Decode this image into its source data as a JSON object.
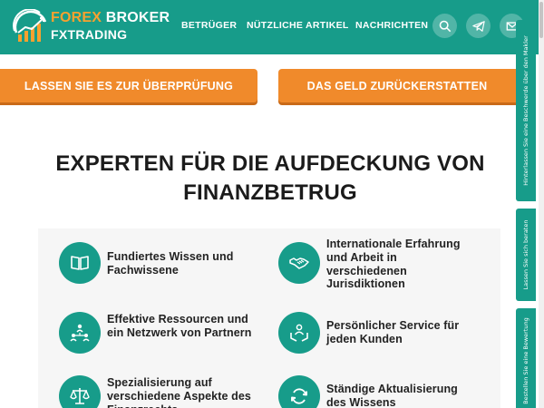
{
  "brand": {
    "line1_accent": "FOREX",
    "line1_rest": " BROKER",
    "line2": "FXTRADING"
  },
  "nav": [
    {
      "label": "BETRÜGER"
    },
    {
      "label": "NÜTZLICHE ARTIKEL"
    },
    {
      "label": "NACHRICHTEN"
    }
  ],
  "header_icons": [
    "search-icon",
    "telegram-icon",
    "mail-icon"
  ],
  "cta": {
    "review_label": "LASSEN SIE ES ZUR ÜBERPRÜFUNG",
    "refund_label": "DAS GELD ZURÜCKERSTATTEN"
  },
  "headline": "EXPERTEN FÜR DIE AUFDECKUNG VON FINANZBETRUG",
  "features": [
    {
      "icon": "book-icon",
      "text": "Fundiertes Wissen und Fachwissene"
    },
    {
      "icon": "handshake-icon",
      "text": "Internationale Erfahrung und Arbeit in verschiedenen Jurisdiktionen"
    },
    {
      "icon": "network-icon",
      "text": "Effektive Ressourcen und ein Netzwerk von Partnern"
    },
    {
      "icon": "personal-service-icon",
      "text": "Persönlicher Service für jeden Kunden"
    },
    {
      "icon": "scales-icon",
      "text": "Spezialisierung auf verschiedene Aspekte des Finanzrechts"
    },
    {
      "icon": "refresh-icon",
      "text": "Ständige Aktualisierung des Wissens"
    }
  ],
  "side_tabs": [
    {
      "label": "Hinterlassen Sie eine Beschwerde über den Makler"
    },
    {
      "label": "Lassen Sie sich beraten"
    },
    {
      "label": "Bestellen Sie eine Bewertung"
    }
  ],
  "colors": {
    "primary": "#179c8a",
    "accent": "#f08a2b",
    "text": "#1b1b1b",
    "panel": "#f6f6f6"
  }
}
